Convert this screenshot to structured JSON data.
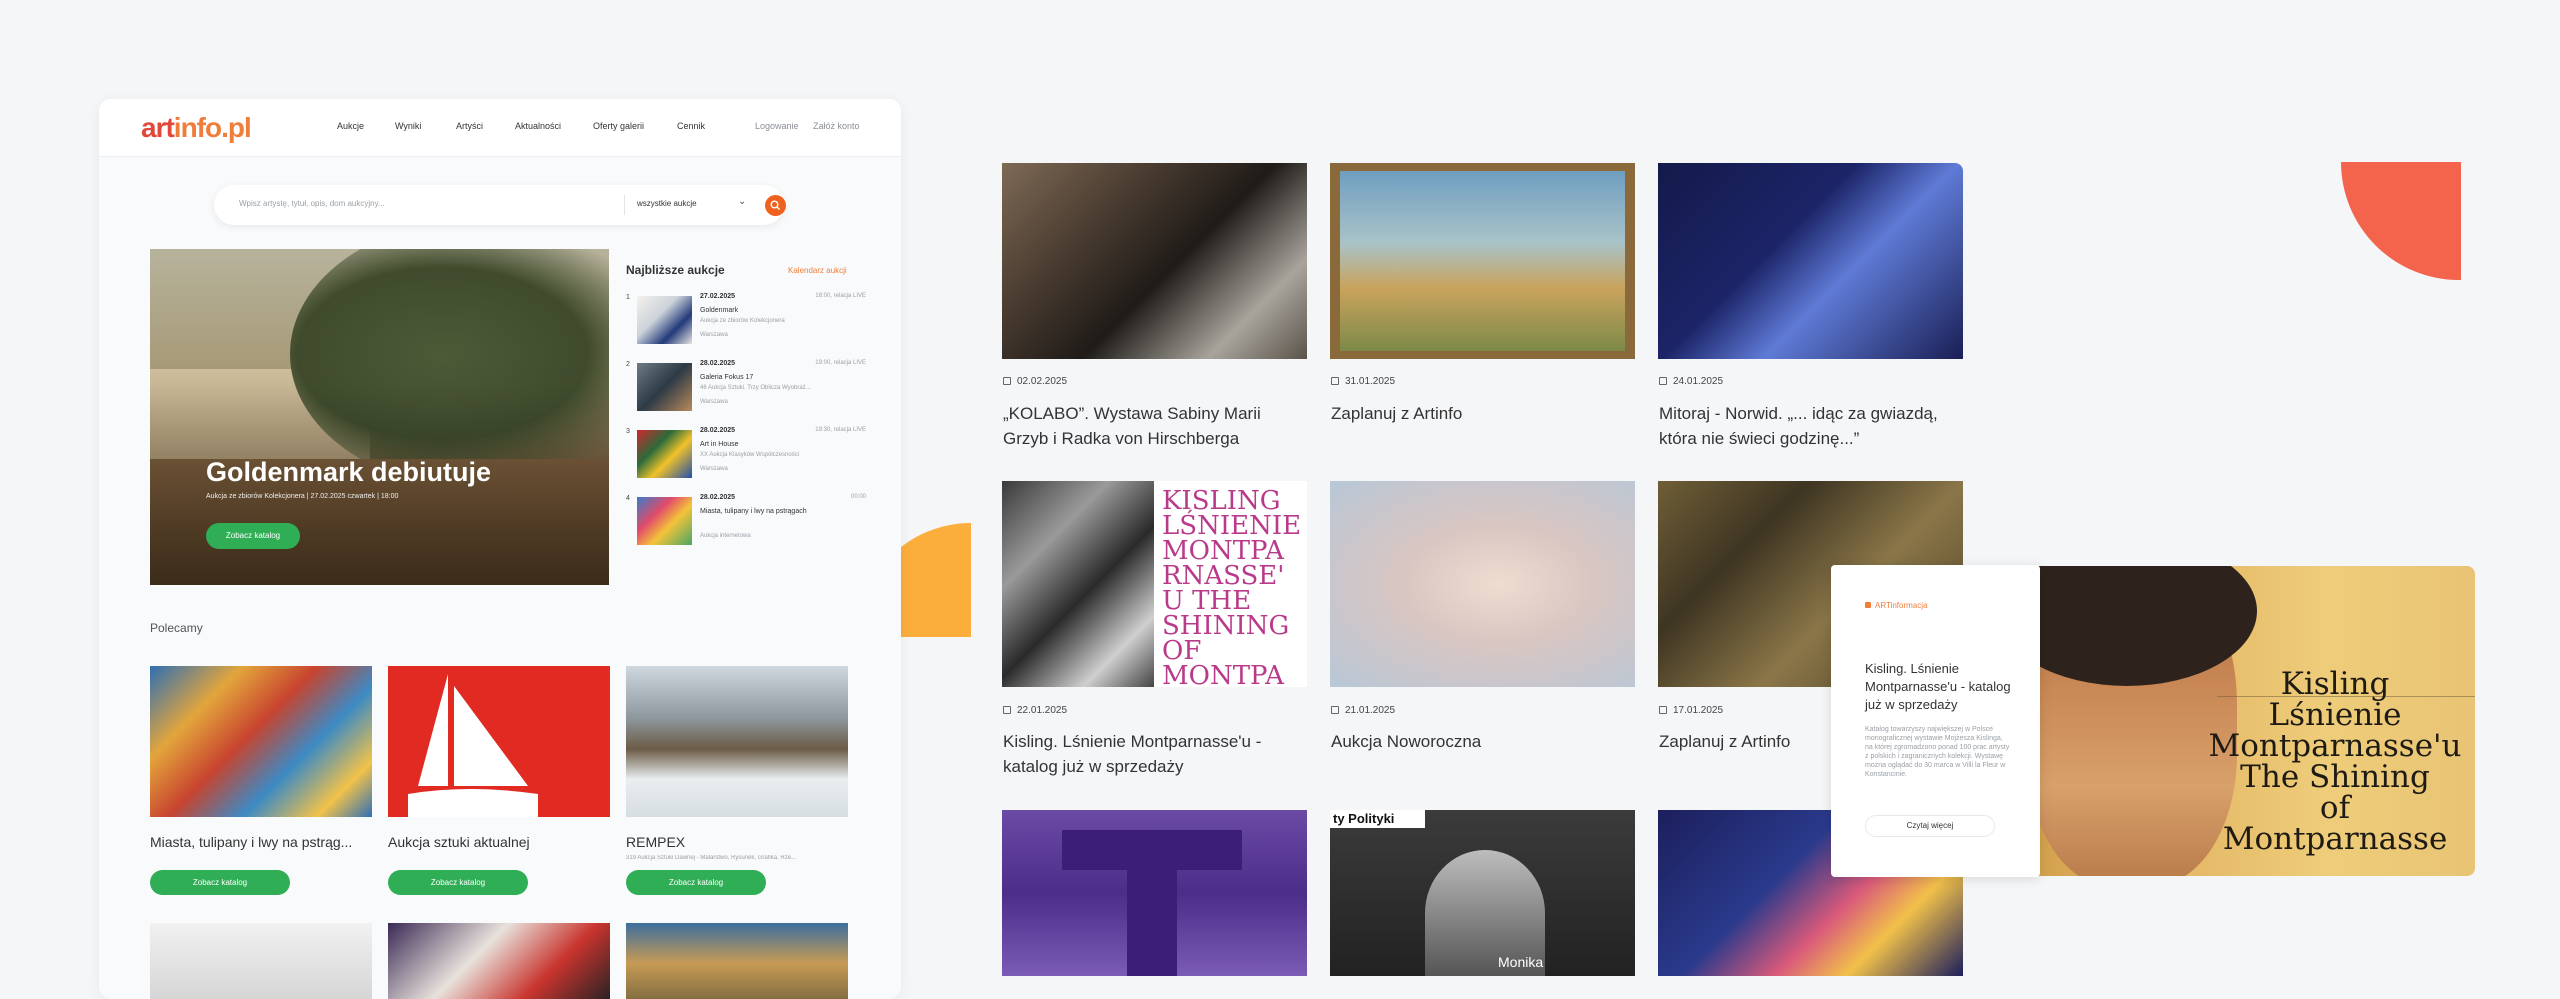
{
  "site": {
    "logo_part1": "art",
    "logo_part2": "info.pl",
    "nav": [
      "Aukcje",
      "Wyniki",
      "Artyści",
      "Aktualności",
      "Oferty galerii",
      "Cennik"
    ],
    "login": "Logowanie",
    "register": "Załóż konto",
    "search_placeholder": "Wpisz artystę, tytuł, opis, dom aukcyjny...",
    "search_select": "wszystkie aukcje"
  },
  "hero": {
    "title": "Goldenmark debiutuje",
    "subtitle": "Aukcja ze zbiorów Kolekcjonera | 27.02.2025 czwartek | 18:00",
    "button": "Zobacz katalog"
  },
  "upcoming": {
    "title": "Najbliższe aukcje",
    "link": "Kalendarz aukcji",
    "items": [
      {
        "num": "1",
        "date": "27.02.2025",
        "time": "18:00, relacja LIVE",
        "name": "Goldenmark",
        "desc": "Aukcja ze zbiorów Kolekcjonera",
        "city": "Warszawa"
      },
      {
        "num": "2",
        "date": "28.02.2025",
        "time": "19:00, relacja LIVE",
        "name": "Galeria Fokus 17",
        "desc": "46 Aukcja Sztuki. Trzy Oblicza Wyobraź...",
        "city": "Warszawa"
      },
      {
        "num": "3",
        "date": "28.02.2025",
        "time": "19:30, relacja LIVE",
        "name": "Art in House",
        "desc": "XX Aukcja Klasyków Współczesności",
        "city": "Warszawa"
      },
      {
        "num": "4",
        "date": "28.02.2025",
        "time": "00:00",
        "name": "Miasta, tulipany i lwy na pstrągach",
        "desc": "",
        "city": "Aukcja internetowa"
      }
    ]
  },
  "recommended": {
    "title": "Polecamy",
    "cards": [
      {
        "title": "Miasta, tulipany i lwy na pstrąg...",
        "desc": "",
        "button": "Zobacz katalog"
      },
      {
        "title": "Aukcja sztuki aktualnej",
        "desc": "",
        "button": "Zobacz katalog"
      },
      {
        "title": "REMPEX",
        "desc": "319 Aukcja Sztuki Dawnej - Malarstwo, Rysunek, Grafika, Rze...",
        "button": "Zobacz katalog"
      }
    ]
  },
  "news": [
    {
      "date": "02.02.2025",
      "title": "„KOLABO”. Wystawa Sabiny Marii Grzyb i Radka von Hirschberga"
    },
    {
      "date": "31.01.2025",
      "title": "Zaplanuj z Artinfo"
    },
    {
      "date": "24.01.2025",
      "title": "Mitoraj - Norwid. „... idąc za gwiazdą, która nie świeci godzinę...”"
    },
    {
      "date": "22.01.2025",
      "title": "Kisling. Lśnienie Montparnasse'u - katalog już w sprzedaży"
    },
    {
      "date": "21.01.2025",
      "title": "Aukcja Noworoczna"
    },
    {
      "date": "17.01.2025",
      "title": "Zaplanuj z Artinfo"
    }
  ],
  "news_image_texts": {
    "kisling_cover_small": "KISLING LŚNIENIE MONTPARNASSE'U THE SHINING OF MONTPARNASSE",
    "polityka": "ty Polityki",
    "monika": "Monika"
  },
  "popup": {
    "tag": "ARTinformacja",
    "title": "Kisling. Lśnienie Montparnasse'u - katalog już w sprzedaży",
    "text": "Katalog towarzyszy największej w Polsce monograficznej wystawie Mojżesza Kislinga, na której zgromadzono ponad 100 prac artysty z polskich i zagranicznych kolekcji. Wystawę można oglądać do 30 marca w Villi la Fleur w Konstancinie.",
    "button": "Czytaj więcej"
  },
  "banner": {
    "title_line1": "Kisling",
    "title_line2": "Lśnienie",
    "title_line3": "Montparnasse'u",
    "title_line4": "The Shining",
    "title_line5": "of Montparnasse"
  },
  "colors": {
    "accent_orange": "#f07d3a",
    "accent_red": "#e2483a",
    "green_button": "#2fae56",
    "shape_yellow": "#fbae3c",
    "shape_coral": "#f4634c"
  }
}
